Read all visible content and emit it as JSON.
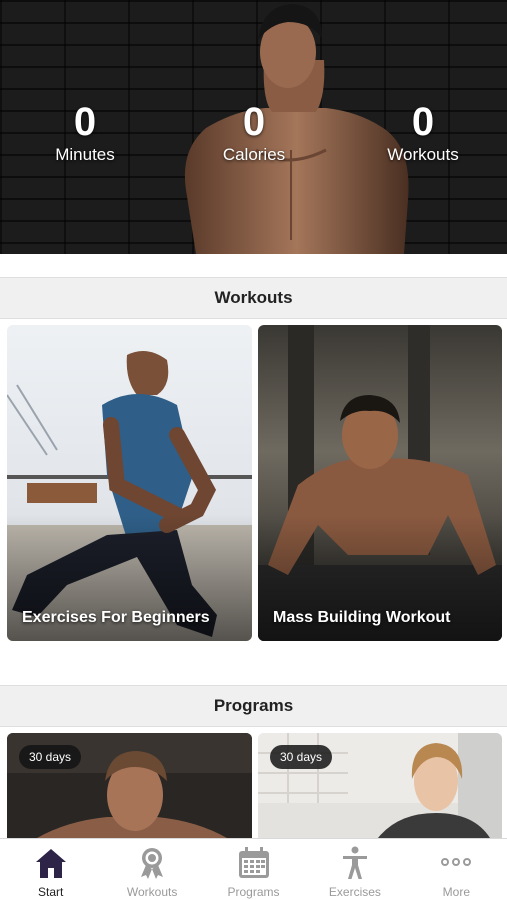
{
  "stats": [
    {
      "value": "0",
      "label": "Minutes"
    },
    {
      "value": "0",
      "label": "Calories"
    },
    {
      "value": "0",
      "label": "Workouts"
    }
  ],
  "workouts_section": {
    "title": "Workouts",
    "cards": [
      {
        "title": "Exercises For Beginners"
      },
      {
        "title": "Mass Building Workout"
      }
    ]
  },
  "programs_section": {
    "title": "Programs",
    "cards": [
      {
        "badge": "30 days"
      },
      {
        "badge": "30 days"
      }
    ]
  },
  "tabbar": {
    "items": [
      {
        "label": "Start",
        "icon": "home-icon",
        "active": true
      },
      {
        "label": "Workouts",
        "icon": "medal-icon",
        "active": false
      },
      {
        "label": "Programs",
        "icon": "calendar-icon",
        "active": false
      },
      {
        "label": "Exercises",
        "icon": "person-icon",
        "active": false
      },
      {
        "label": "More",
        "icon": "more-dots-icon",
        "active": false
      }
    ]
  },
  "colors": {
    "active_tab": "#1f1f1f",
    "active_icon": "#2e2447",
    "inactive_tab": "#9a9a9a",
    "section_header_bg": "#f0f0f0"
  }
}
